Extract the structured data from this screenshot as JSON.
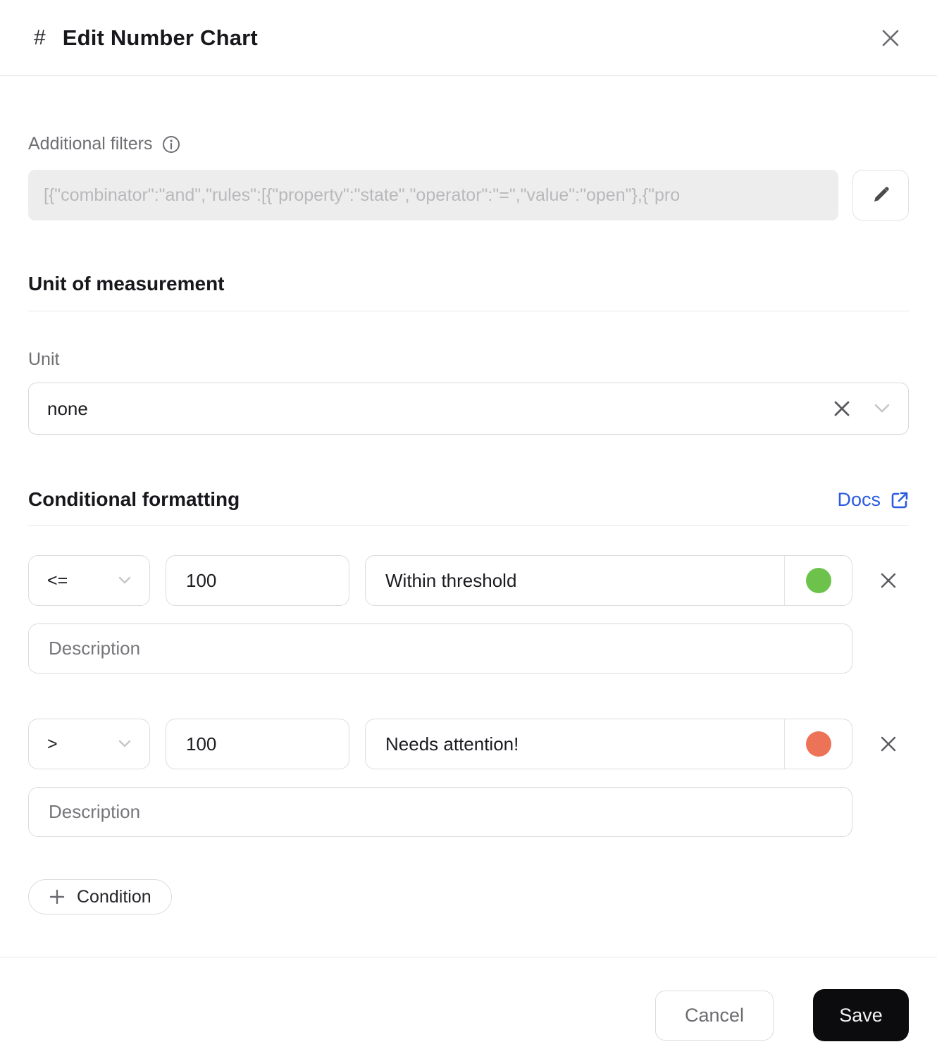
{
  "header": {
    "hash_icon": "#",
    "title": "Edit Number Chart"
  },
  "filters": {
    "label": "Additional filters",
    "value": "[{\"combinator\":\"and\",\"rules\":[{\"property\":\"state\",\"operator\":\"=\",\"value\":\"open\"},{\"pro"
  },
  "unit_section": {
    "heading": "Unit of measurement",
    "unit_label": "Unit",
    "unit_value": "none"
  },
  "conditional": {
    "heading": "Conditional formatting",
    "docs_label": "Docs",
    "conditions": [
      {
        "operator": "<=",
        "value": "100",
        "label": "Within threshold",
        "color": "#6cc24a",
        "description_placeholder": "Description"
      },
      {
        "operator": ">",
        "value": "100",
        "label": "Needs attention!",
        "color": "#ec7357",
        "description_placeholder": "Description"
      }
    ],
    "add_button_label": "Condition"
  },
  "footer": {
    "cancel_label": "Cancel",
    "save_label": "Save"
  },
  "colors": {
    "accent_link": "#2b5ce0",
    "condition_green": "#6cc24a",
    "condition_red": "#ec7357",
    "save_bg": "#0c0c0e"
  }
}
